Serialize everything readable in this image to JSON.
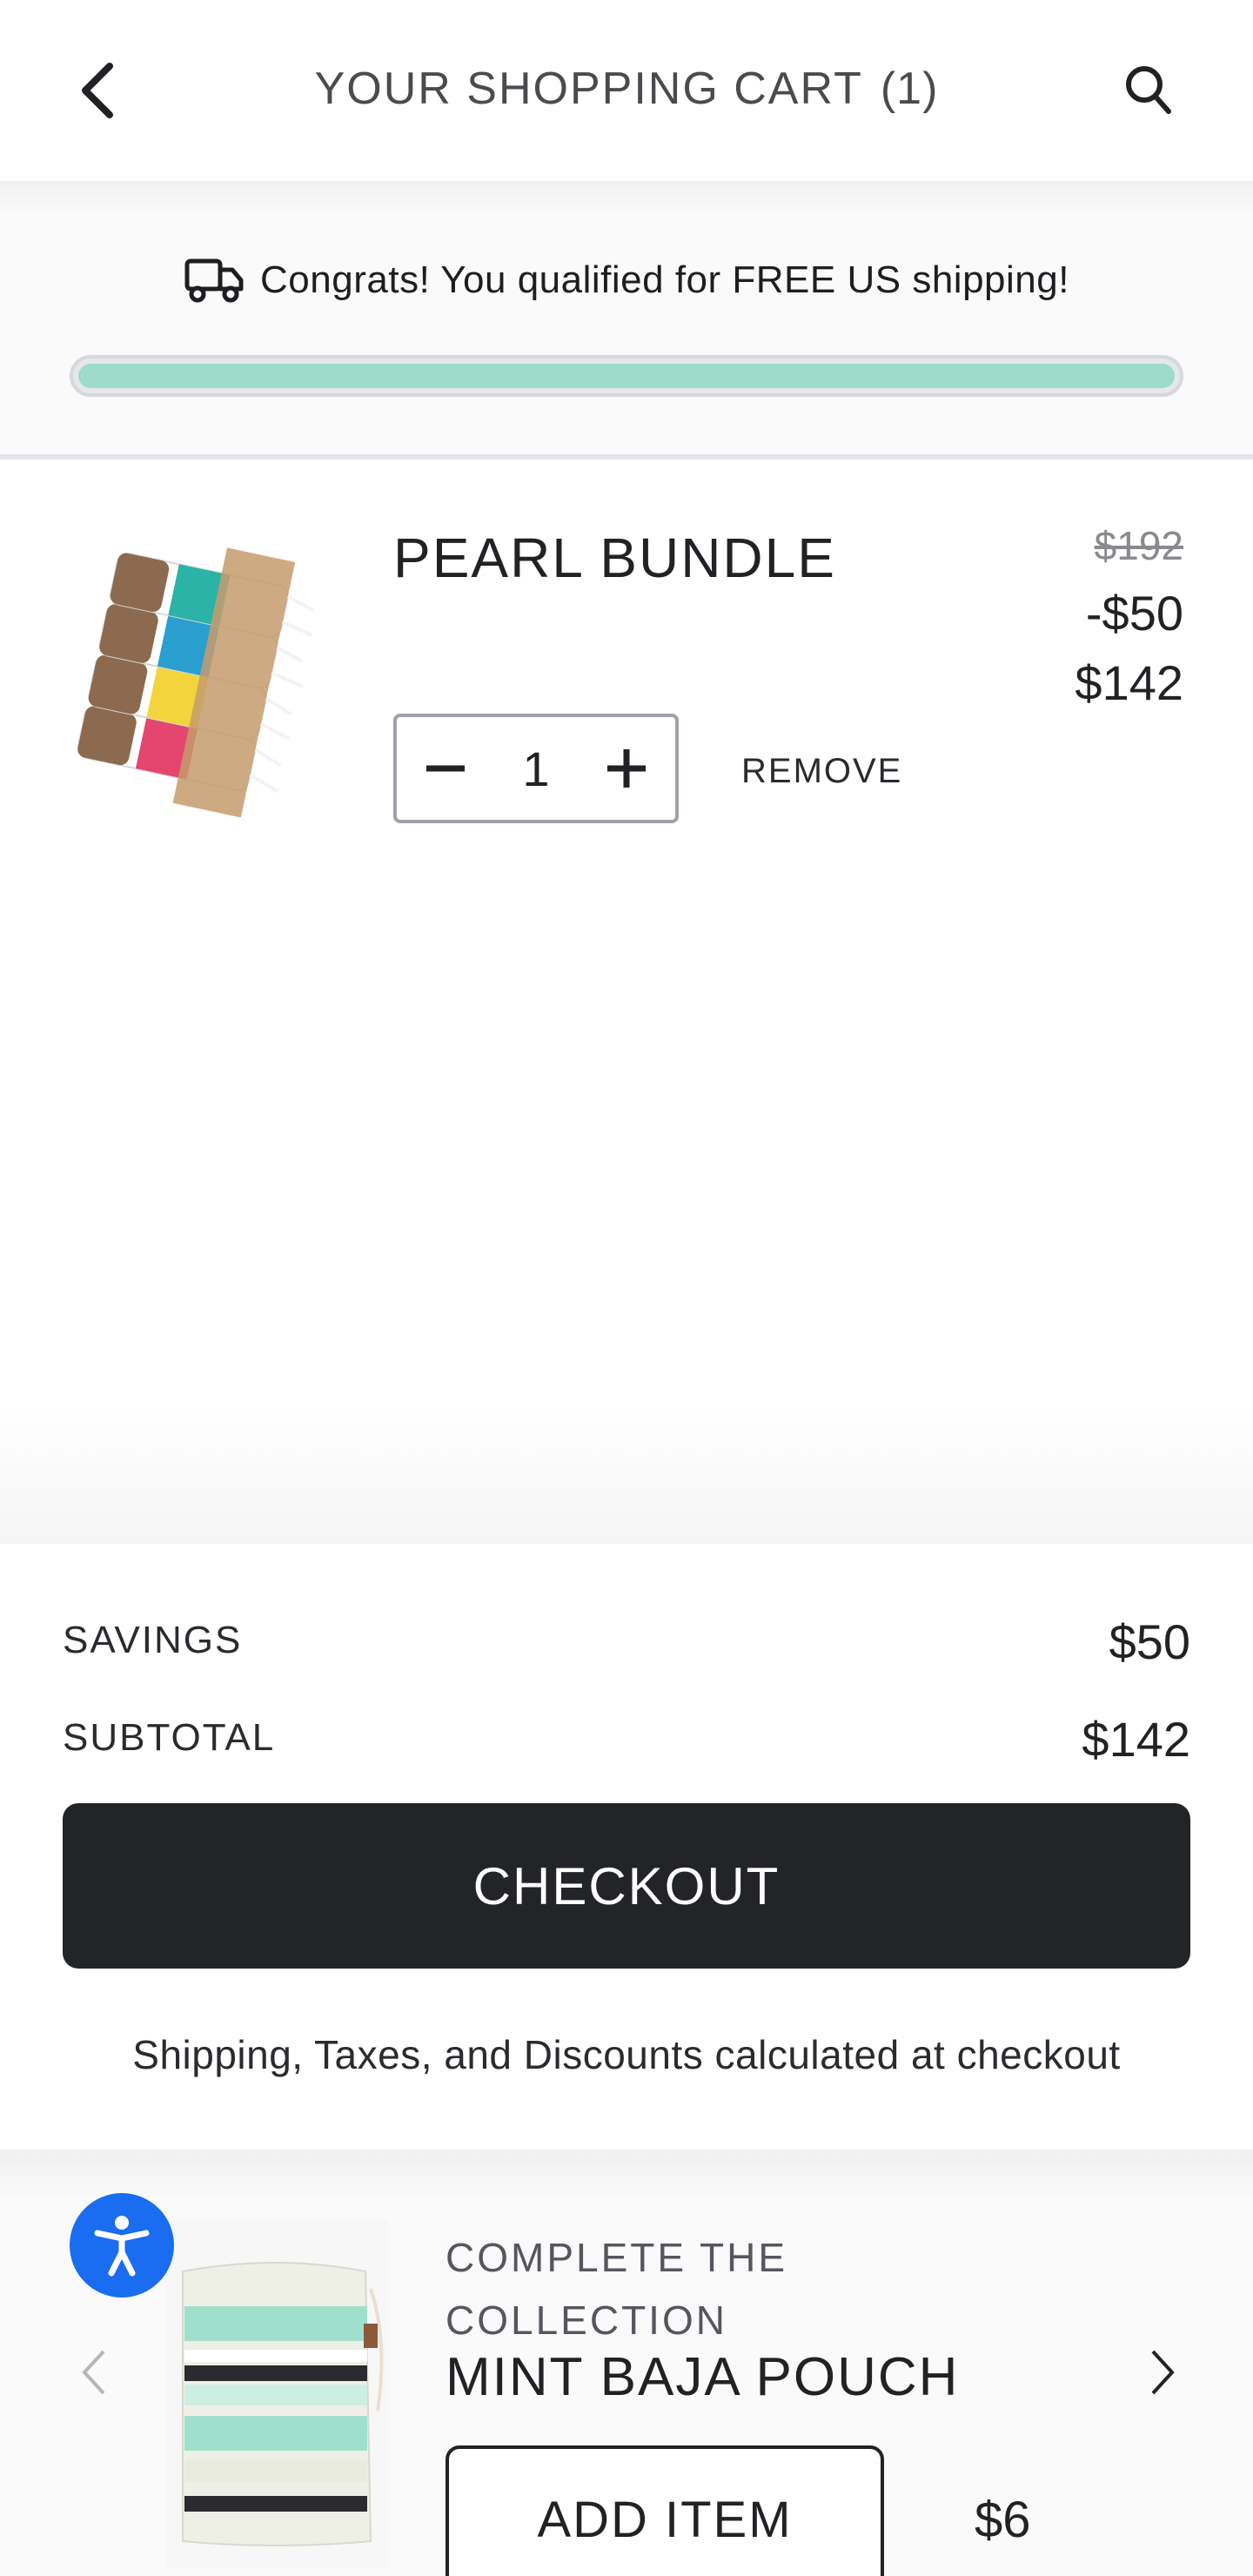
{
  "header": {
    "title": "YOUR SHOPPING CART",
    "count": "(1)",
    "back_icon": "chevron-left-icon",
    "search_icon": "search-icon"
  },
  "shipping": {
    "icon": "truck-icon",
    "message": "Congrats! You qualified for FREE US shipping!",
    "progress": 1.0,
    "progress_color": "#9cdcc9"
  },
  "cart": {
    "items": [
      {
        "name": "PEARL BUNDLE",
        "original_price": "$192",
        "discount": "-$50",
        "price": "$142",
        "quantity": "1",
        "remove_label": "REMOVE"
      }
    ]
  },
  "summary": {
    "savings_label": "SAVINGS",
    "savings_value": "$50",
    "subtotal_label": "SUBTOTAL",
    "subtotal_value": "$142",
    "checkout_label": "CHECKOUT",
    "note": "Shipping, Taxes, and Discounts calculated at checkout"
  },
  "upsell": {
    "kicker": "COMPLETE THE COLLECTION",
    "name": "MINT BAJA POUCH",
    "add_label": "ADD ITEM",
    "price": "$6",
    "accessibility_icon": "accessibility-icon",
    "accent_color": "#1a6cf0"
  }
}
